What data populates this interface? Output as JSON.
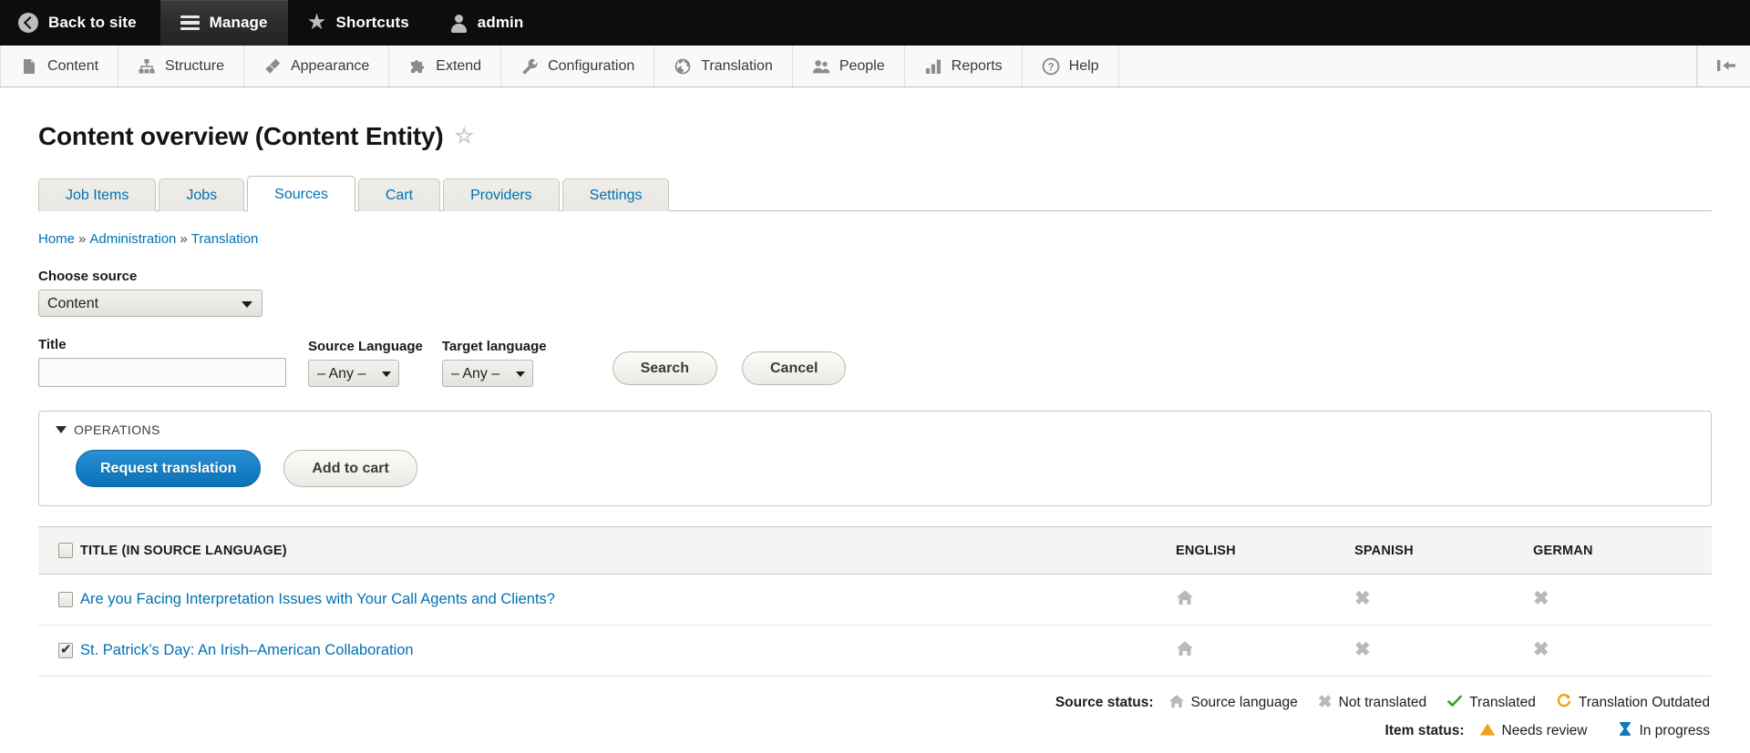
{
  "admin_bar": {
    "items": [
      {
        "label": "Back to site",
        "icon": "back-circle-icon",
        "active": false
      },
      {
        "label": "Manage",
        "icon": "hamburger-icon",
        "active": true
      },
      {
        "label": "Shortcuts",
        "icon": "star-icon",
        "active": false
      },
      {
        "label": "admin",
        "icon": "person-icon",
        "active": false
      }
    ]
  },
  "menu_bar": {
    "items": [
      {
        "label": "Content",
        "icon": "document-icon"
      },
      {
        "label": "Structure",
        "icon": "sitemap-icon"
      },
      {
        "label": "Appearance",
        "icon": "paintbrush-icon"
      },
      {
        "label": "Extend",
        "icon": "puzzle-icon"
      },
      {
        "label": "Configuration",
        "icon": "wrench-icon"
      },
      {
        "label": "Translation",
        "icon": "globe-icon"
      },
      {
        "label": "People",
        "icon": "people-icon"
      },
      {
        "label": "Reports",
        "icon": "bar-chart-icon"
      },
      {
        "label": "Help",
        "icon": "question-circle-icon"
      }
    ],
    "collapse_icon": "collapse-toolbar-icon"
  },
  "page": {
    "title": "Content overview (Content Entity)",
    "favorite_icon": "☆"
  },
  "tabs": [
    {
      "label": "Job Items",
      "active": false
    },
    {
      "label": "Jobs",
      "active": false
    },
    {
      "label": "Sources",
      "active": true
    },
    {
      "label": "Cart",
      "active": false
    },
    {
      "label": "Providers",
      "active": false
    },
    {
      "label": "Settings",
      "active": false
    }
  ],
  "breadcrumb": {
    "items": [
      "Home",
      "Administration",
      "Translation"
    ],
    "separator": "»"
  },
  "form": {
    "choose_source_label": "Choose source",
    "choose_source_value": "Content",
    "title_label": "Title",
    "title_value": "",
    "title_placeholder": "",
    "source_language_label": "Source Language",
    "source_language_value": "– Any –",
    "target_language_label": "Target language",
    "target_language_value": "– Any –",
    "search_label": "Search",
    "cancel_label": "Cancel"
  },
  "operations": {
    "legend": "OPERATIONS",
    "request_translation_label": "Request translation",
    "add_to_cart_label": "Add to cart",
    "primary_color": "#0b72b8"
  },
  "table": {
    "headers": {
      "title": "TITLE (IN SOURCE LANGUAGE)",
      "english": "ENGLISH",
      "spanish": "SPANISH",
      "german": "GERMAN"
    },
    "select_all_checked": false,
    "rows": [
      {
        "checked": false,
        "title": "Are you Facing Interpretation Issues with Your Call Agents and Clients?",
        "english": "source-language-icon",
        "spanish": "not-translated-icon",
        "german": "not-translated-icon"
      },
      {
        "checked": true,
        "title": "St. Patrick’s Day: An Irish–American Collaboration",
        "english": "source-language-icon",
        "spanish": "not-translated-icon",
        "german": "not-translated-icon"
      }
    ]
  },
  "legend": {
    "source_status_label": "Source status:",
    "source_items": [
      {
        "icon": "home-icon",
        "label": "Source language",
        "color": "#b9b9b9"
      },
      {
        "icon": "x-icon",
        "label": "Not translated",
        "color": "#b9b9b9"
      },
      {
        "icon": "check-icon",
        "label": "Translated",
        "color": "#3a9b27"
      },
      {
        "icon": "outdated-icon",
        "label": "Translation Outdated",
        "color": "#e8a20c"
      }
    ],
    "item_status_label": "Item status:",
    "item_items": [
      {
        "icon": "warning-triangle-icon",
        "label": "Needs review",
        "color": "#f0a216"
      },
      {
        "icon": "hourglass-icon",
        "label": "In progress",
        "color": "#1378b8"
      }
    ]
  }
}
